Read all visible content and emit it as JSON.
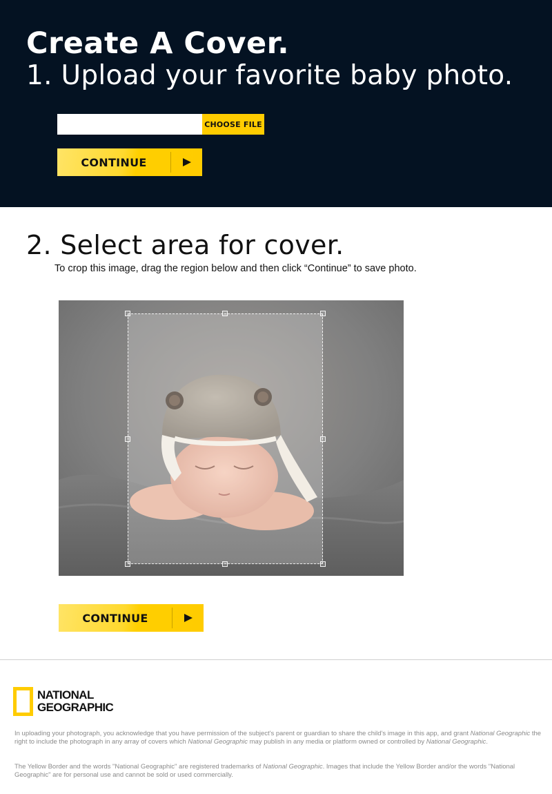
{
  "hero": {
    "title": "Create A Cover.",
    "step1": "1. Upload your favorite baby photo.",
    "choose_file_label": "CHOOSE FILE",
    "continue_label": "CONTINUE"
  },
  "step2": {
    "title": "2. Select area for cover.",
    "description": "To crop this image, drag the region below and then click “Continue” to save photo.",
    "continue_label": "CONTINUE"
  },
  "footer": {
    "logo_line1": "NATIONAL",
    "logo_line2": "GEOGRAPHIC",
    "legal1_a": "In uploading your photograph, you acknowledge that you have permission of the subject's parent or guardian to share the child's image in this app, and grant ",
    "legal1_b": "National Geographic",
    "legal1_c": " the right to include the photograph in any array of covers which ",
    "legal1_d": "National Geographic",
    "legal1_e": " may publish in any media or platform owned or controlled by ",
    "legal1_f": "National Geographic",
    "legal1_g": ".",
    "legal2_a": "The Yellow Border and the words \"National Geographic\" are registered trademarks of ",
    "legal2_b": "National Geographic",
    "legal2_c": ". Images that include the Yellow Border and/or the words \"National Geographic\" are for personal use and cannot be sold or used commercially."
  },
  "colors": {
    "hero_bg": "#041222",
    "accent_yellow": "#ffcc00"
  },
  "icons": {
    "continue_arrow": "play-arrow-icon"
  }
}
